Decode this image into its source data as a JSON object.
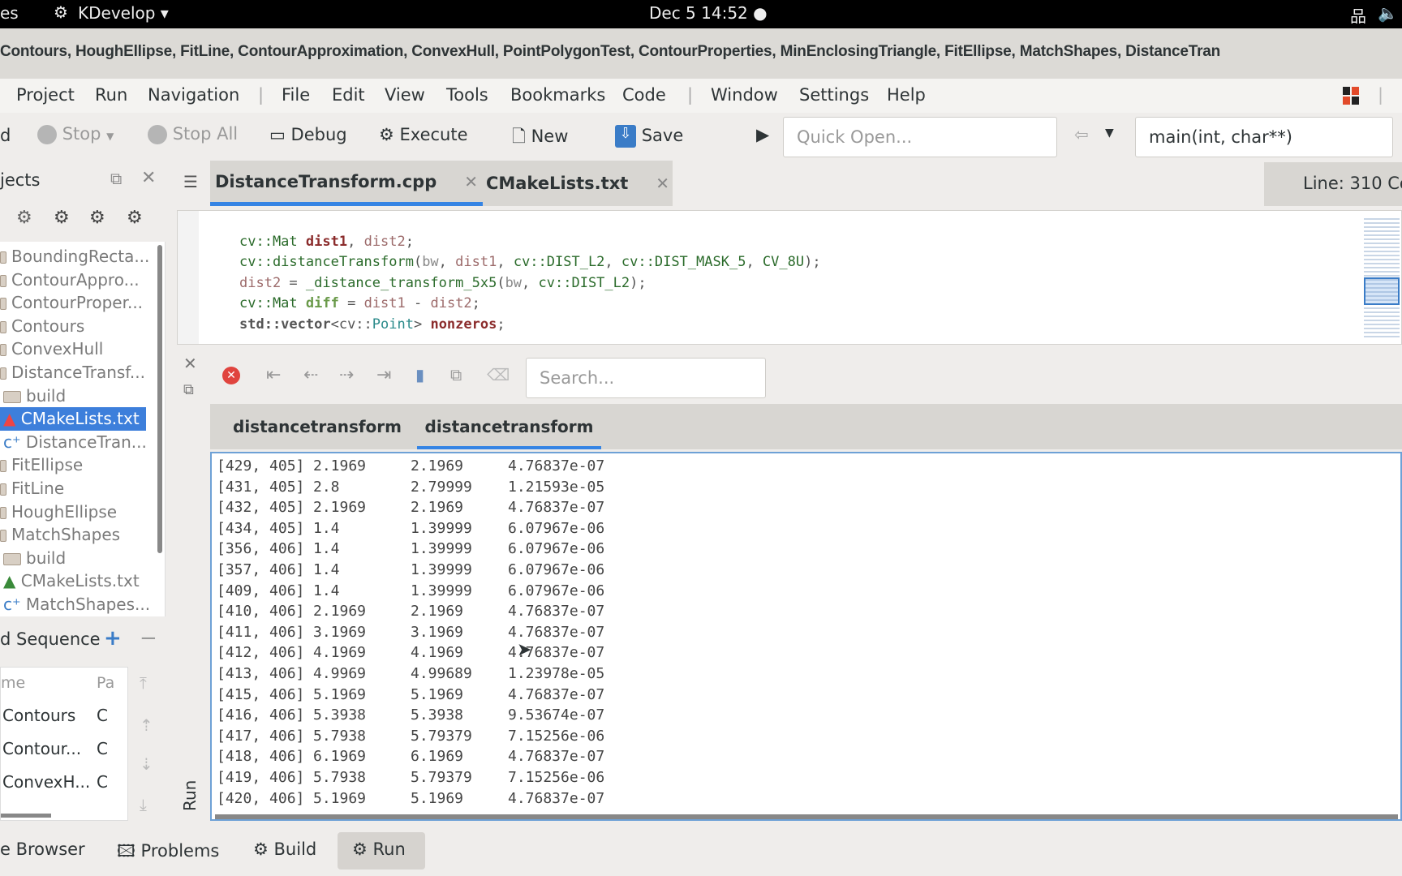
{
  "topbar": {
    "activities": "es",
    "app_name": "KDevelop ▾",
    "clock": "Dec 5  14:52 ●",
    "network_icon": "network-icon",
    "volume_icon": "volume-icon"
  },
  "window": {
    "title": "Contours, HoughEllipse, FitLine, ContourApproximation, ConvexHull, PointPolygonTest, ContourProperties, MinEnclosingTriangle, FitEllipse, MatchShapes, DistanceTran"
  },
  "menu": [
    "Project",
    "Run",
    "Navigation",
    "File",
    "Edit",
    "View",
    "Tools",
    "Bookmarks",
    "Code",
    "Window",
    "Settings",
    "Help"
  ],
  "toolbar": {
    "build_partial": "d",
    "stop": "Stop",
    "stop_all": "Stop All",
    "debug": "Debug",
    "execute": "Execute",
    "new": "New",
    "save": "Save",
    "quick_open_placeholder": "Quick Open...",
    "context": "main(int, char**)"
  },
  "projects": {
    "title": "jects",
    "items": [
      {
        "label": "BoundingRecta...",
        "type": "project"
      },
      {
        "label": "ContourAppro...",
        "type": "project"
      },
      {
        "label": "ContourProper...",
        "type": "project"
      },
      {
        "label": "Contours",
        "type": "project"
      },
      {
        "label": "ConvexHull",
        "type": "project"
      },
      {
        "label": "DistanceTransf...",
        "type": "project"
      },
      {
        "label": "build",
        "type": "folder"
      },
      {
        "label": "CMakeLists.txt",
        "type": "cmake",
        "selected": true
      },
      {
        "label": "DistanceTran...",
        "type": "cpp"
      },
      {
        "label": "FitEllipse",
        "type": "project"
      },
      {
        "label": "FitLine",
        "type": "project"
      },
      {
        "label": "HoughEllipse",
        "type": "project"
      },
      {
        "label": "MatchShapes",
        "type": "project"
      },
      {
        "label": "build",
        "type": "folder"
      },
      {
        "label": "CMakeLists.txt",
        "type": "cmake"
      },
      {
        "label": "MatchShapes...",
        "type": "cpp"
      }
    ]
  },
  "build_sequence": {
    "title": "d Sequence",
    "col_name": "me",
    "col_path": "Pa",
    "rows": [
      {
        "name": "Contours",
        "path": "C"
      },
      {
        "name": "Contour...",
        "path": "C"
      },
      {
        "name": "ConvexH...",
        "path": "C"
      }
    ]
  },
  "editor": {
    "tabs": [
      {
        "label": "DistanceTransform.cpp",
        "active": true
      },
      {
        "label": "CMakeLists.txt",
        "active": false
      }
    ],
    "status": "Line: 310 Co"
  },
  "output": {
    "search_placeholder": "Search...",
    "tabs": [
      {
        "label": "distancetransform",
        "active": false
      },
      {
        "label": "distancetransform",
        "active": true
      }
    ],
    "side_label": "Run",
    "rows": [
      [
        "[429, 405]",
        "2.1969",
        "2.1969",
        "4.76837e-07"
      ],
      [
        "[431, 405]",
        "2.8",
        "2.79999",
        "1.21593e-05"
      ],
      [
        "[432, 405]",
        "2.1969",
        "2.1969",
        "4.76837e-07"
      ],
      [
        "[434, 405]",
        "1.4",
        "1.39999",
        "6.07967e-06"
      ],
      [
        "[356, 406]",
        "1.4",
        "1.39999",
        "6.07967e-06"
      ],
      [
        "[357, 406]",
        "1.4",
        "1.39999",
        "6.07967e-06"
      ],
      [
        "[409, 406]",
        "1.4",
        "1.39999",
        "6.07967e-06"
      ],
      [
        "[410, 406]",
        "2.1969",
        "2.1969",
        "4.76837e-07"
      ],
      [
        "[411, 406]",
        "3.1969",
        "3.1969",
        "4.76837e-07"
      ],
      [
        "[412, 406]",
        "4.1969",
        "4.1969",
        "4.76837e-07"
      ],
      [
        "[413, 406]",
        "4.9969",
        "4.99689",
        "1.23978e-05"
      ],
      [
        "[415, 406]",
        "5.1969",
        "5.1969",
        "4.76837e-07"
      ],
      [
        "[416, 406]",
        "5.3938",
        "5.3938",
        "9.53674e-07"
      ],
      [
        "[417, 406]",
        "5.7938",
        "5.79379",
        "7.15256e-06"
      ],
      [
        "[418, 406]",
        "6.1969",
        "6.1969",
        "4.76837e-07"
      ],
      [
        "[419, 406]",
        "5.7938",
        "5.79379",
        "7.15256e-06"
      ],
      [
        "[420, 406]",
        "5.1969",
        "5.1969",
        "4.76837e-07"
      ]
    ]
  },
  "bottom_tabs": [
    {
      "label": "e Browser"
    },
    {
      "label": "Problems"
    },
    {
      "label": "Build"
    },
    {
      "label": "Run",
      "active": true
    }
  ],
  "colors": {
    "accent": "#3584e4",
    "selection": "#3d7fdb"
  }
}
